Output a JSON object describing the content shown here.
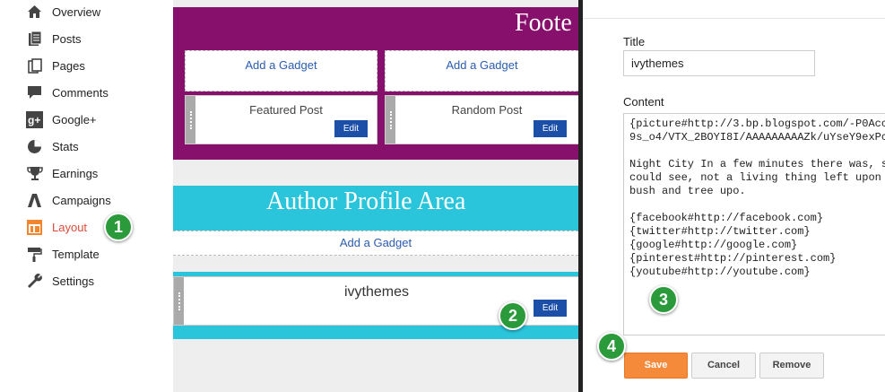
{
  "sidebar": {
    "items": [
      {
        "label": "Overview",
        "icon": "home-icon"
      },
      {
        "label": "Posts",
        "icon": "posts-icon"
      },
      {
        "label": "Pages",
        "icon": "pages-icon"
      },
      {
        "label": "Comments",
        "icon": "comment-icon"
      },
      {
        "label": "Google+",
        "icon": "google-plus-icon"
      },
      {
        "label": "Stats",
        "icon": "pie-chart-icon"
      },
      {
        "label": "Earnings",
        "icon": "trophy-icon"
      },
      {
        "label": "Campaigns",
        "icon": "campaigns-icon"
      },
      {
        "label": "Layout",
        "icon": "layout-icon",
        "active": true
      },
      {
        "label": "Template",
        "icon": "paint-roller-icon"
      },
      {
        "label": "Settings",
        "icon": "wrench-icon"
      }
    ],
    "active_color": "#dd4b39"
  },
  "layout": {
    "footer_title": "Foote",
    "footer_color": "#87106c",
    "footer_add_gadget_1": "Add a Gadget",
    "footer_add_gadget_2": "Add a Gadget",
    "featured_post": "Featured Post",
    "random_post": "Random Post",
    "edit_label": "Edit",
    "author_title": "Author Profile Area",
    "author_color": "#2ac4db",
    "author_add_gadget": "Add a Gadget",
    "author_gadget": "ivythemes"
  },
  "panel": {
    "title_label": "Title",
    "title_value": "ivythemes",
    "content_label": "Content",
    "content_value": "{picture#http://3.bp.blogspot.com/-P0Acc\n9s_o4/VTX_2BOYI8I/AAAAAAAAAZk/uYseY9exPc\n\nNight City In a few minutes there was, s\ncould see, not a living thing left upon\nbush and tree upo.\n\n{facebook#http://facebook.com}\n{twitter#http://twitter.com}\n{google#http://google.com}\n{pinterest#http://pinterest.com}\n{youtube#http://youtube.com}",
    "save_label": "Save",
    "cancel_label": "Cancel",
    "remove_label": "Remove"
  },
  "markers": [
    "1",
    "2",
    "3",
    "4"
  ]
}
